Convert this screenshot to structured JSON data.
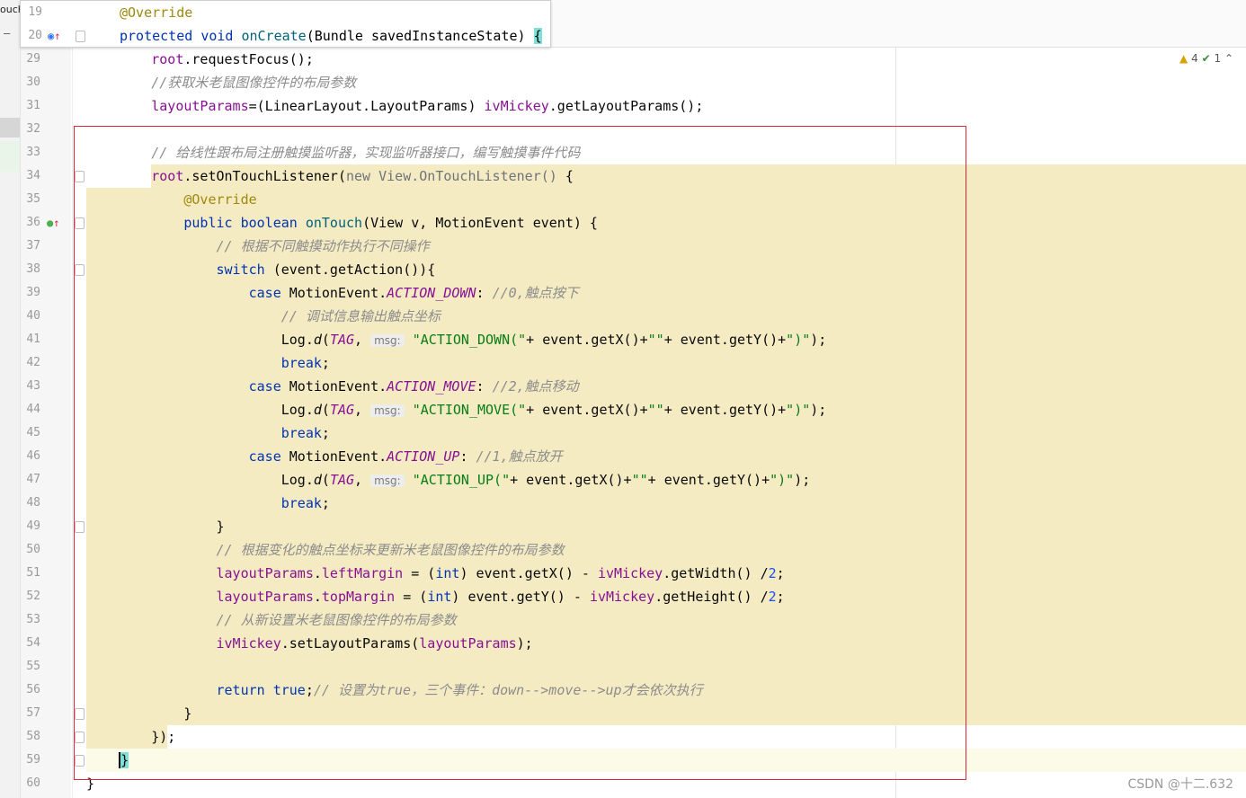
{
  "left_tab": {
    "label": "ouch",
    "collapse_symbol": "—"
  },
  "header_lines": [
    {
      "num": "19",
      "segments": [
        {
          "t": "@Override",
          "c": "ann"
        }
      ]
    },
    {
      "num": "20",
      "segments": [
        {
          "t": "protected ",
          "c": "kw"
        },
        {
          "t": "void ",
          "c": "kw"
        },
        {
          "t": "onCreate",
          "c": "fn"
        },
        {
          "t": "(Bundle savedInstanceState) ",
          "c": ""
        },
        {
          "t": "{",
          "c": "bracket"
        }
      ]
    }
  ],
  "inspections": {
    "warnings": "4",
    "weak_warnings": "1",
    "warn_icon": "▲",
    "ok_icon": "✔",
    "arrow": "⌃"
  },
  "watermark": "CSDN @十二.632",
  "lines": [
    {
      "num": "29",
      "segments": [
        {
          "t": "        root",
          "c": "fld"
        },
        {
          "t": ".requestFocus();",
          "c": ""
        }
      ]
    },
    {
      "num": "30",
      "segments": [
        {
          "t": "        //获取米老鼠图像控件的布局参数",
          "c": "cmt"
        }
      ]
    },
    {
      "num": "31",
      "segments": [
        {
          "t": "        layoutParams",
          "c": "fld"
        },
        {
          "t": "=(LinearLayout.LayoutParams) ",
          "c": ""
        },
        {
          "t": "ivMickey",
          "c": "fld"
        },
        {
          "t": ".getLayoutParams();",
          "c": ""
        }
      ]
    },
    {
      "num": "32",
      "segments": []
    },
    {
      "num": "33",
      "segments": [
        {
          "t": "        // 给线性跟布局注册触摸监听器，实现监听器接口，编写触摸事件代码",
          "c": "cmt"
        }
      ]
    },
    {
      "num": "34",
      "segments": [
        {
          "t": "        root",
          "c": "fld"
        },
        {
          "t": ".setOnTouchListener(",
          "c": ""
        },
        {
          "t": "new View.OnTouchListener()",
          "c": "anon"
        },
        {
          "t": " {",
          "c": ""
        }
      ]
    },
    {
      "num": "35",
      "segments": [
        {
          "t": "            @Override",
          "c": "ann"
        }
      ]
    },
    {
      "num": "36",
      "segments": [
        {
          "t": "            public ",
          "c": "kw"
        },
        {
          "t": "boolean ",
          "c": "kw"
        },
        {
          "t": "onTouch",
          "c": "fn"
        },
        {
          "t": "(View v, MotionEvent event) {",
          "c": ""
        }
      ]
    },
    {
      "num": "37",
      "segments": [
        {
          "t": "                // 根据不同触摸动作执行不同操作",
          "c": "cmt"
        }
      ]
    },
    {
      "num": "38",
      "segments": [
        {
          "t": "                switch ",
          "c": "kw"
        },
        {
          "t": "(event.getAction()){",
          "c": ""
        }
      ]
    },
    {
      "num": "39",
      "segments": [
        {
          "t": "                    case ",
          "c": "kw"
        },
        {
          "t": "MotionEvent.",
          "c": ""
        },
        {
          "t": "ACTION_DOWN",
          "c": "sfld"
        },
        {
          "t": ": ",
          "c": ""
        },
        {
          "t": "//0,触点按下",
          "c": "cmt"
        }
      ]
    },
    {
      "num": "40",
      "segments": [
        {
          "t": "                        // 调试信息输出触点坐标",
          "c": "cmt"
        }
      ]
    },
    {
      "num": "41",
      "segments": [
        {
          "t": "                        Log.",
          "c": ""
        },
        {
          "t": "d",
          "c": "italic"
        },
        {
          "t": "(",
          "c": ""
        },
        {
          "t": "TAG",
          "c": "sfld"
        },
        {
          "t": ", ",
          "c": ""
        },
        {
          "t": "msg:",
          "c": "hint"
        },
        {
          "t": " \"ACTION_DOWN(\"",
          "c": "str"
        },
        {
          "t": "+ event.getX()+",
          "c": ""
        },
        {
          "t": "\"\"",
          "c": "str"
        },
        {
          "t": "+ event.getY()+",
          "c": ""
        },
        {
          "t": "\")\"",
          "c": "str"
        },
        {
          "t": ");",
          "c": ""
        }
      ]
    },
    {
      "num": "42",
      "segments": [
        {
          "t": "                        break",
          "c": "kw"
        },
        {
          "t": ";",
          "c": ""
        }
      ]
    },
    {
      "num": "43",
      "segments": [
        {
          "t": "                    case ",
          "c": "kw"
        },
        {
          "t": "MotionEvent.",
          "c": ""
        },
        {
          "t": "ACTION_MOVE",
          "c": "sfld"
        },
        {
          "t": ": ",
          "c": ""
        },
        {
          "t": "//2,触点移动",
          "c": "cmt"
        }
      ]
    },
    {
      "num": "44",
      "segments": [
        {
          "t": "                        Log.",
          "c": ""
        },
        {
          "t": "d",
          "c": "italic"
        },
        {
          "t": "(",
          "c": ""
        },
        {
          "t": "TAG",
          "c": "sfld"
        },
        {
          "t": ", ",
          "c": ""
        },
        {
          "t": "msg:",
          "c": "hint"
        },
        {
          "t": " \"ACTION_MOVE(\"",
          "c": "str"
        },
        {
          "t": "+ event.getX()+",
          "c": ""
        },
        {
          "t": "\"\"",
          "c": "str"
        },
        {
          "t": "+ event.getY()+",
          "c": ""
        },
        {
          "t": "\")\"",
          "c": "str"
        },
        {
          "t": ");",
          "c": ""
        }
      ]
    },
    {
      "num": "45",
      "segments": [
        {
          "t": "                        break",
          "c": "kw"
        },
        {
          "t": ";",
          "c": ""
        }
      ]
    },
    {
      "num": "46",
      "segments": [
        {
          "t": "                    case ",
          "c": "kw"
        },
        {
          "t": "MotionEvent.",
          "c": ""
        },
        {
          "t": "ACTION_UP",
          "c": "sfld"
        },
        {
          "t": ": ",
          "c": ""
        },
        {
          "t": "//1,触点放开",
          "c": "cmt"
        }
      ]
    },
    {
      "num": "47",
      "segments": [
        {
          "t": "                        Log.",
          "c": ""
        },
        {
          "t": "d",
          "c": "italic"
        },
        {
          "t": "(",
          "c": ""
        },
        {
          "t": "TAG",
          "c": "sfld"
        },
        {
          "t": ", ",
          "c": ""
        },
        {
          "t": "msg:",
          "c": "hint"
        },
        {
          "t": " \"ACTION_UP(\"",
          "c": "str"
        },
        {
          "t": "+ event.getX()+",
          "c": ""
        },
        {
          "t": "\"\"",
          "c": "str"
        },
        {
          "t": "+ event.getY()+",
          "c": ""
        },
        {
          "t": "\")\"",
          "c": "str"
        },
        {
          "t": ");",
          "c": ""
        }
      ]
    },
    {
      "num": "48",
      "segments": [
        {
          "t": "                        break",
          "c": "kw"
        },
        {
          "t": ";",
          "c": ""
        }
      ]
    },
    {
      "num": "49",
      "segments": [
        {
          "t": "                }",
          "c": ""
        }
      ]
    },
    {
      "num": "50",
      "segments": [
        {
          "t": "                // 根据变化的触点坐标来更新米老鼠图像控件的布局参数",
          "c": "cmt"
        }
      ]
    },
    {
      "num": "51",
      "segments": [
        {
          "t": "                layoutParams",
          "c": "fld"
        },
        {
          "t": ".",
          "c": ""
        },
        {
          "t": "leftMargin",
          "c": "fld"
        },
        {
          "t": " = (",
          "c": ""
        },
        {
          "t": "int",
          "c": "kw"
        },
        {
          "t": ") event.getX() - ",
          "c": ""
        },
        {
          "t": "ivMickey",
          "c": "fld"
        },
        {
          "t": ".getWidth() /",
          "c": ""
        },
        {
          "t": "2",
          "c": "num-lit"
        },
        {
          "t": ";",
          "c": ""
        }
      ]
    },
    {
      "num": "52",
      "segments": [
        {
          "t": "                layoutParams",
          "c": "fld"
        },
        {
          "t": ".",
          "c": ""
        },
        {
          "t": "topMargin",
          "c": "fld"
        },
        {
          "t": " = (",
          "c": ""
        },
        {
          "t": "int",
          "c": "kw"
        },
        {
          "t": ") event.getY() - ",
          "c": ""
        },
        {
          "t": "ivMickey",
          "c": "fld"
        },
        {
          "t": ".getHeight() /",
          "c": ""
        },
        {
          "t": "2",
          "c": "num-lit"
        },
        {
          "t": ";",
          "c": ""
        }
      ]
    },
    {
      "num": "53",
      "segments": [
        {
          "t": "                // 从新设置米老鼠图像控件的布局参数",
          "c": "cmt"
        }
      ]
    },
    {
      "num": "54",
      "segments": [
        {
          "t": "                ivMickey",
          "c": "fld"
        },
        {
          "t": ".setLayoutParams(",
          "c": ""
        },
        {
          "t": "layoutParams",
          "c": "fld"
        },
        {
          "t": ");",
          "c": ""
        }
      ]
    },
    {
      "num": "55",
      "segments": []
    },
    {
      "num": "56",
      "segments": [
        {
          "t": "                return ",
          "c": "kw"
        },
        {
          "t": "true",
          "c": "kw"
        },
        {
          "t": ";",
          "c": ""
        },
        {
          "t": "// 设置为true，三个事件：down-->move-->up才会依次执行",
          "c": "cmt"
        }
      ]
    },
    {
      "num": "57",
      "segments": [
        {
          "t": "            }",
          "c": ""
        }
      ]
    },
    {
      "num": "58",
      "segments": [
        {
          "t": "        });",
          "c": ""
        }
      ]
    },
    {
      "num": "59",
      "segments": [
        {
          "t": "    ",
          "c": ""
        },
        {
          "t": "}",
          "c": "bracket"
        }
      ]
    },
    {
      "num": "60",
      "segments": [
        {
          "t": "}",
          "c": ""
        }
      ]
    }
  ]
}
